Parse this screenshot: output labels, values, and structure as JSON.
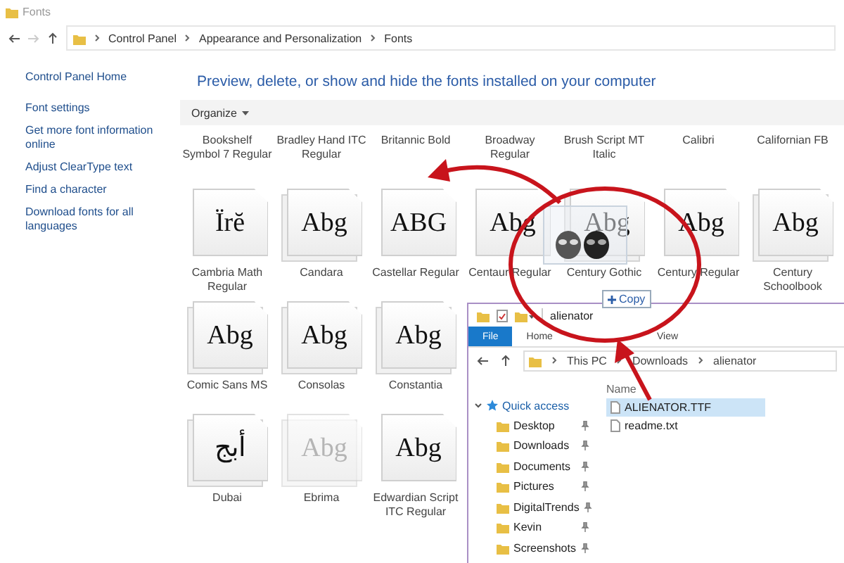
{
  "window": {
    "title": "Fonts"
  },
  "address_bar": {
    "path": [
      "Control Panel",
      "Appearance and Personalization",
      "Fonts"
    ]
  },
  "sidebar": {
    "items": [
      {
        "label": "Control Panel Home"
      },
      {
        "label": "Font settings"
      },
      {
        "label": "Get more font information online"
      },
      {
        "label": "Adjust ClearType text"
      },
      {
        "label": "Find a character"
      },
      {
        "label": "Download fonts for all languages"
      }
    ]
  },
  "heading": "Preview, delete, or show and hide the fonts installed on your computer",
  "toolbar": {
    "organize": "Organize"
  },
  "font_rows": [
    [
      {
        "kind": "label",
        "name": "Bookshelf Symbol 7 Regular"
      },
      {
        "kind": "label",
        "name": "Bradley Hand ITC Regular"
      },
      {
        "kind": "label",
        "name": "Britannic Bold"
      },
      {
        "kind": "label",
        "name": "Broadway Regular"
      },
      {
        "kind": "label",
        "name": "Brush Script MT Italic"
      },
      {
        "kind": "label",
        "name": "Calibri"
      },
      {
        "kind": "label",
        "name": "Californian FB"
      }
    ],
    [
      {
        "kind": "tile",
        "name": "Cambria Math Regular",
        "sample": "Ïrĕ",
        "family": false,
        "hidden": false
      },
      {
        "kind": "tile",
        "name": "Candara",
        "sample": "Abg",
        "family": true,
        "hidden": false
      },
      {
        "kind": "tile",
        "name": "Castellar Regular",
        "sample": "ABG",
        "family": false,
        "hidden": false
      },
      {
        "kind": "tile",
        "name": "Centaur Regular",
        "sample": "Abg",
        "family": false,
        "hidden": false
      },
      {
        "kind": "tile",
        "name": "Century Gothic",
        "sample": "Abg",
        "family": true,
        "hidden": false
      },
      {
        "kind": "tile",
        "name": "Century Regular",
        "sample": "Abg",
        "family": false,
        "hidden": false
      },
      {
        "kind": "tile",
        "name": "Century Schoolbook",
        "sample": "Abg",
        "family": true,
        "hidden": false
      }
    ],
    [
      {
        "kind": "tile",
        "name": "Comic Sans MS",
        "sample": "Abg",
        "family": true,
        "hidden": false
      },
      {
        "kind": "tile",
        "name": "Consolas",
        "sample": "Abg",
        "family": true,
        "hidden": false
      },
      {
        "kind": "tile",
        "name": "Constantia",
        "sample": "Abg",
        "family": true,
        "hidden": false
      }
    ],
    [
      {
        "kind": "tile",
        "name": "Dubai",
        "sample": "أبج",
        "family": true,
        "hidden": false
      },
      {
        "kind": "tile",
        "name": "Ebrima",
        "sample": "Abg",
        "family": true,
        "hidden": true
      },
      {
        "kind": "tile",
        "name": "Edwardian Script ITC Regular",
        "sample": "Abg",
        "family": false,
        "hidden": false
      }
    ]
  ],
  "explorer": {
    "title": "alienator",
    "ribbon_tabs": [
      {
        "label": "File",
        "selected": true
      },
      {
        "label": "Home",
        "selected": false
      },
      {
        "label": "View",
        "selected": false
      }
    ],
    "path": [
      "This PC",
      "Downloads",
      "alienator"
    ],
    "quick_access": {
      "label": "Quick access",
      "expanded": true,
      "children": [
        {
          "label": "Desktop",
          "pinned": true
        },
        {
          "label": "Downloads",
          "pinned": true
        },
        {
          "label": "Documents",
          "pinned": true
        },
        {
          "label": "Pictures",
          "pinned": true
        },
        {
          "label": "DigitalTrends",
          "pinned": true
        },
        {
          "label": "Kevin",
          "pinned": true
        },
        {
          "label": "Screenshots",
          "pinned": true
        }
      ]
    },
    "column": "Name",
    "files": [
      {
        "name": "ALIENATOR.TTF",
        "selected": true
      },
      {
        "name": "readme.txt",
        "selected": false
      }
    ]
  },
  "drag": {
    "badge": "Copy"
  }
}
